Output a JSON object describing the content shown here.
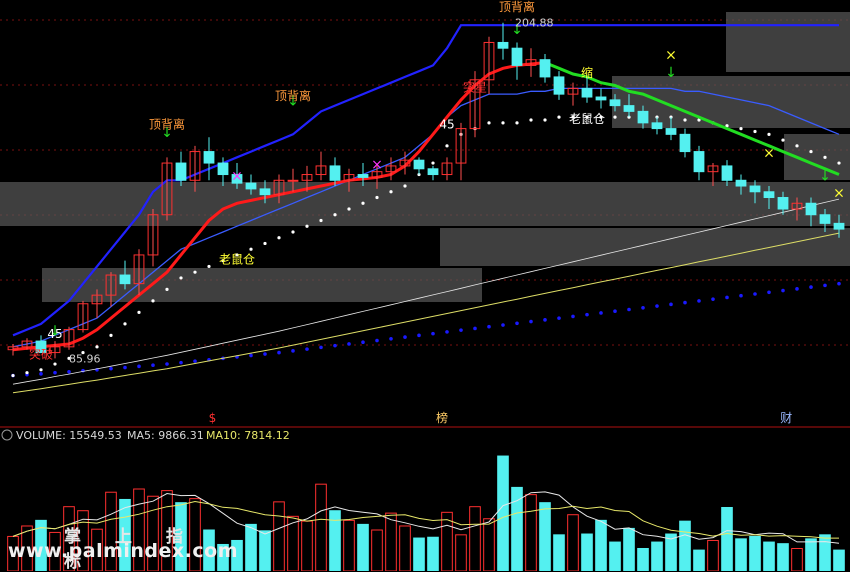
{
  "chart_data": {
    "type": "candlestick",
    "price_axis": {
      "min": 85.96,
      "max": 204.88,
      "grid": true
    },
    "price_labels": {
      "high": "204.88",
      "low": "85.96"
    },
    "candles": [
      [
        91,
        93,
        89,
        92
      ],
      [
        92,
        95,
        91,
        94
      ],
      [
        94,
        96,
        92,
        90
      ],
      [
        90,
        94,
        88,
        92
      ],
      [
        92,
        99,
        91,
        98
      ],
      [
        98,
        108,
        97,
        107
      ],
      [
        107,
        112,
        102,
        110
      ],
      [
        110,
        118,
        106,
        117
      ],
      [
        117,
        122,
        112,
        114
      ],
      [
        114,
        126,
        110,
        124
      ],
      [
        124,
        140,
        120,
        138
      ],
      [
        138,
        158,
        136,
        156
      ],
      [
        156,
        160,
        148,
        150
      ],
      [
        150,
        162,
        146,
        160
      ],
      [
        160,
        165,
        150,
        156
      ],
      [
        156,
        158,
        148,
        152
      ],
      [
        152,
        156,
        147,
        149
      ],
      [
        149,
        152,
        145,
        147
      ],
      [
        147,
        150,
        142,
        145
      ],
      [
        145,
        152,
        142,
        150
      ],
      [
        150,
        154,
        146,
        150
      ],
      [
        150,
        155,
        146,
        152
      ],
      [
        152,
        160,
        150,
        155
      ],
      [
        155,
        158,
        148,
        150
      ],
      [
        150,
        154,
        146,
        152
      ],
      [
        152,
        156,
        148,
        151
      ],
      [
        151,
        155,
        147,
        153
      ],
      [
        153,
        158,
        150,
        155
      ],
      [
        155,
        160,
        152,
        157
      ],
      [
        157,
        158,
        152,
        154
      ],
      [
        154,
        155,
        150,
        152
      ],
      [
        152,
        158,
        150,
        156
      ],
      [
        156,
        170,
        150,
        168
      ],
      [
        168,
        188,
        165,
        185
      ],
      [
        185,
        200,
        180,
        198
      ],
      [
        198,
        204.88,
        192,
        196
      ],
      [
        196,
        198,
        185,
        190
      ],
      [
        190,
        196,
        186,
        192
      ],
      [
        192,
        194,
        184,
        186
      ],
      [
        186,
        188,
        178,
        180
      ],
      [
        180,
        184,
        176,
        182
      ],
      [
        182,
        186,
        177,
        179
      ],
      [
        179,
        182,
        175,
        178
      ],
      [
        178,
        180,
        174,
        176
      ],
      [
        176,
        180,
        172,
        174
      ],
      [
        174,
        176,
        168,
        170
      ],
      [
        170,
        172,
        166,
        168
      ],
      [
        168,
        172,
        164,
        166
      ],
      [
        166,
        168,
        158,
        160
      ],
      [
        160,
        162,
        150,
        153
      ],
      [
        153,
        156,
        148,
        155
      ],
      [
        155,
        157,
        148,
        150
      ],
      [
        150,
        152,
        145,
        148
      ],
      [
        148,
        150,
        142,
        146
      ],
      [
        146,
        148,
        140,
        144
      ],
      [
        144,
        146,
        138,
        140
      ],
      [
        140,
        144,
        136,
        142
      ],
      [
        142,
        144,
        134,
        138
      ],
      [
        138,
        140,
        132,
        135
      ],
      [
        135,
        138,
        130,
        133
      ]
    ],
    "trend_line": [
      91,
      91.5,
      92,
      92.5,
      93,
      95,
      98,
      102,
      106,
      110,
      114,
      118,
      124,
      130,
      136,
      140,
      142,
      143,
      144,
      145,
      146,
      147,
      148,
      149,
      150,
      150.5,
      151,
      152,
      155,
      160,
      166,
      172,
      178,
      183,
      187,
      189,
      190,
      190.5,
      191,
      189,
      187,
      186,
      184,
      183,
      181,
      180,
      178,
      176,
      174,
      172,
      170,
      168,
      166,
      164,
      162,
      160,
      158,
      156,
      154,
      152
    ],
    "upper_band": [
      96,
      98,
      100,
      104,
      108,
      114,
      120,
      126,
      132,
      138,
      146,
      150,
      150,
      152,
      154,
      156,
      158,
      160,
      162,
      164,
      166,
      170,
      174,
      176,
      178,
      180,
      182,
      184,
      186,
      188,
      190,
      196,
      204,
      204,
      204,
      204,
      204,
      204,
      204,
      204,
      204,
      204,
      204,
      204,
      204,
      204,
      204,
      204,
      204,
      204,
      204,
      204,
      204,
      204,
      204,
      204,
      204,
      204,
      204,
      204
    ],
    "mid_band": [
      92,
      93,
      94,
      96,
      98,
      100,
      102,
      106,
      110,
      114,
      118,
      122,
      126,
      128,
      130,
      132,
      134,
      136,
      138,
      140,
      142,
      144,
      146,
      148,
      150,
      152,
      154,
      156,
      158,
      162,
      166,
      172,
      176,
      178,
      180,
      180,
      180,
      181,
      181,
      182,
      182,
      182,
      182,
      182,
      182,
      182,
      182,
      182,
      181,
      181,
      180,
      179,
      178,
      177,
      176,
      174,
      172,
      170,
      168,
      166
    ],
    "support_dots": [
      82,
      82.3,
      82.6,
      83,
      83.3,
      83.7,
      84,
      84.4,
      84.8,
      85.2,
      85.6,
      86,
      86.5,
      87,
      87.5,
      88,
      88.5,
      89,
      89.5,
      90,
      90.6,
      91.2,
      91.8,
      92.4,
      93,
      93.6,
      94.2,
      94.8,
      95.4,
      96,
      96.6,
      97.2,
      97.8,
      98.4,
      99,
      99.6,
      100.2,
      100.8,
      101.4,
      102,
      102.6,
      103.2,
      103.8,
      104.4,
      105,
      105.6,
      106.2,
      106.8,
      107.4,
      108,
      108.6,
      109.2,
      109.8,
      110.4,
      111,
      111.6,
      112.2,
      112.8,
      113.4,
      114
    ],
    "annotations": [
      {
        "text": "顶背离",
        "i": 11,
        "price": 168,
        "color": "#ff9a3c"
      },
      {
        "text": "顶背离",
        "i": 20,
        "price": 178,
        "color": "#ff9a3c"
      },
      {
        "text": "顶背离",
        "i": 36,
        "price": 209,
        "color": "#ff9a3c"
      },
      {
        "text": "老鼠仓",
        "i": 16,
        "price": 121,
        "color": "#ffff33"
      },
      {
        "text": "老鼠仓",
        "i": 41,
        "price": 170,
        "color": "#ffffff"
      },
      {
        "text": "突破",
        "i": 2,
        "price": 88,
        "color": "#ff3030"
      },
      {
        "text": "突星",
        "i": 33,
        "price": 181,
        "color": "#ff3030"
      },
      {
        "text": "缩",
        "i": 41,
        "price": 186,
        "color": "#ffff33"
      },
      {
        "text": "45",
        "i": 31,
        "price": 168,
        "color": "#ffffff"
      },
      {
        "text": "45",
        "i": 3,
        "price": 95,
        "color": "#ffffff"
      }
    ],
    "event_markers": [
      {
        "text": "$",
        "x_frac": 0.25,
        "color": "#ff3030"
      },
      {
        "text": "榜",
        "x_frac": 0.52,
        "color": "#ffcc66"
      },
      {
        "text": "财",
        "x_frac": 0.925,
        "color": "#9ab8ff"
      }
    ],
    "volume": {
      "label": "VOLUME: 15549.53",
      "ma5_label": "MA5: 9866.31",
      "ma10_label": "MA10: 7814.12",
      "values": [
        4300,
        5600,
        6300,
        4800,
        8000,
        7500,
        5200,
        9800,
        8900,
        10200,
        9300,
        10000,
        8500,
        9000,
        5100,
        3300,
        3800,
        5800,
        5000,
        8600,
        6800,
        6200,
        10800,
        7500,
        6300,
        5800,
        5100,
        7200,
        5600,
        4100,
        4200,
        7300,
        4500,
        8000,
        6500,
        14300,
        10400,
        9500,
        8500,
        4500,
        7000,
        4600,
        6300,
        3600,
        5300,
        2800,
        3600,
        4600,
        6200,
        2600,
        3800,
        7900,
        4000,
        4300,
        3600,
        3400,
        2800,
        4000,
        4500,
        2600
      ]
    }
  },
  "watermark": {
    "line1": "掌 上 指 标",
    "line2": "www.palmindex.com"
  }
}
